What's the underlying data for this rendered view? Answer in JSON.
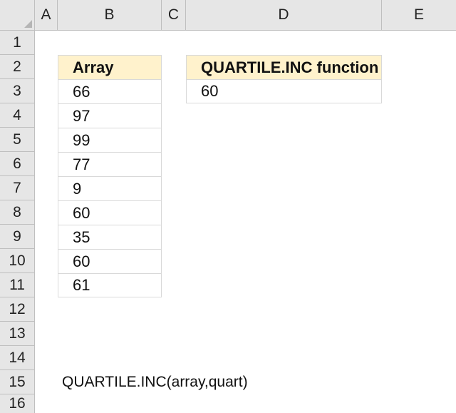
{
  "columns": [
    "A",
    "B",
    "C",
    "D",
    "E"
  ],
  "rows": [
    "1",
    "2",
    "3",
    "4",
    "5",
    "6",
    "7",
    "8",
    "9",
    "10",
    "11",
    "12",
    "13",
    "14",
    "15",
    "16"
  ],
  "array_table": {
    "header": "Array",
    "values": [
      "66",
      "97",
      "99",
      "77",
      "9",
      "60",
      "35",
      "60",
      "61"
    ]
  },
  "function_table": {
    "header": "QUARTILE.INC function",
    "result": "60"
  },
  "syntax_text": "QUARTILE.INC(array,quart)"
}
